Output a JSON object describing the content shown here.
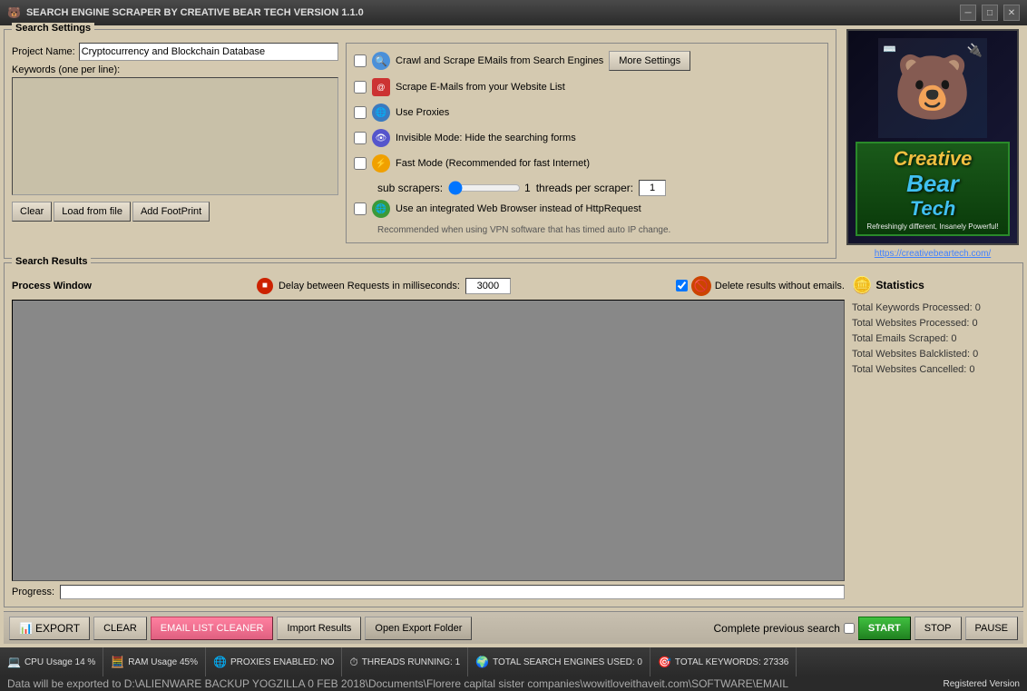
{
  "titlebar": {
    "title": "SEARCH ENGINE SCRAPER BY CREATIVE BEAR TECH VERSION 1.1.0",
    "icon": "🐻"
  },
  "search_settings": {
    "panel_label": "Search Settings",
    "project_label": "Project Name:",
    "project_value": "Cryptocurrency and Blockchain Database",
    "keywords_label": "Keywords (one per line):",
    "keywords_value": "",
    "buttons": {
      "clear": "Clear",
      "load": "Load from file",
      "add_footprint": "Add FootPrint"
    },
    "options": {
      "crawl_label": "Crawl and Scrape EMails from Search Engines",
      "scrape_label": "Scrape E-Mails from your Website List",
      "proxies_label": "Use Proxies",
      "invisible_label": "Invisible Mode: Hide the searching forms",
      "fast_mode_label": "Fast Mode (Recommended for fast Internet)",
      "fast_sub_scrapers": "sub scrapers:",
      "fast_scraper_value": "1",
      "fast_threads_label": "threads per scraper:",
      "fast_threads_value": "1",
      "browser_label": "Use an integrated Web Browser instead of HttpRequest",
      "vpn_note": "Recommended when using VPN software that has timed auto IP change.",
      "more_settings": "More Settings"
    }
  },
  "logo": {
    "bear_emoji": "🐻",
    "creative": "Creative",
    "bear": "Bear",
    "tech": "Tech",
    "tagline": "Refreshingly different, Insanely Powerful!",
    "url": "https://creativebeartech.com/"
  },
  "search_results": {
    "panel_label": "Search Results",
    "process_window_label": "Process Window",
    "delay_label": "Delay between Requests in milliseconds:",
    "delay_value": "3000",
    "delete_label": "Delete results without emails.",
    "progress_label": "Progress:",
    "progress_value": 0,
    "statistics": {
      "title": "Statistics",
      "total_keywords": "Total Keywords Processed: 0",
      "total_websites": "Total Websites Processed: 0",
      "total_emails": "Total Emails Scraped: 0",
      "total_blacklisted": "Total Websites Balcklisted: 0",
      "total_cancelled": "Total Websites Cancelled: 0"
    }
  },
  "toolbar": {
    "export": "EXPORT",
    "clear": "CLEAR",
    "email_cleaner": "EMAIL LIST CLEANER",
    "import_results": "Import Results",
    "open_export": "Open Export Folder",
    "complete_previous": "Complete previous search",
    "start": "START",
    "stop": "STOP",
    "pause": "PAUSE"
  },
  "statusbar": {
    "cpu": "CPU Usage 14 %",
    "ram": "RAM Usage 45%",
    "proxies": "PROXIES ENABLED: NO",
    "threads": "THREADS RUNNING: 1",
    "search_engines": "TOTAL SEARCH ENGINES USED: 0",
    "keywords": "TOTAL KEYWORDS: 27336",
    "data_path": "Data will be exported to D:\\ALIENWARE BACKUP YOGZILLA 0 FEB 2018\\Documents\\Florere capital sister companies\\wowitloveithaveit.com\\SOFTWARE\\EMAIL",
    "registered": "Registered Version"
  }
}
